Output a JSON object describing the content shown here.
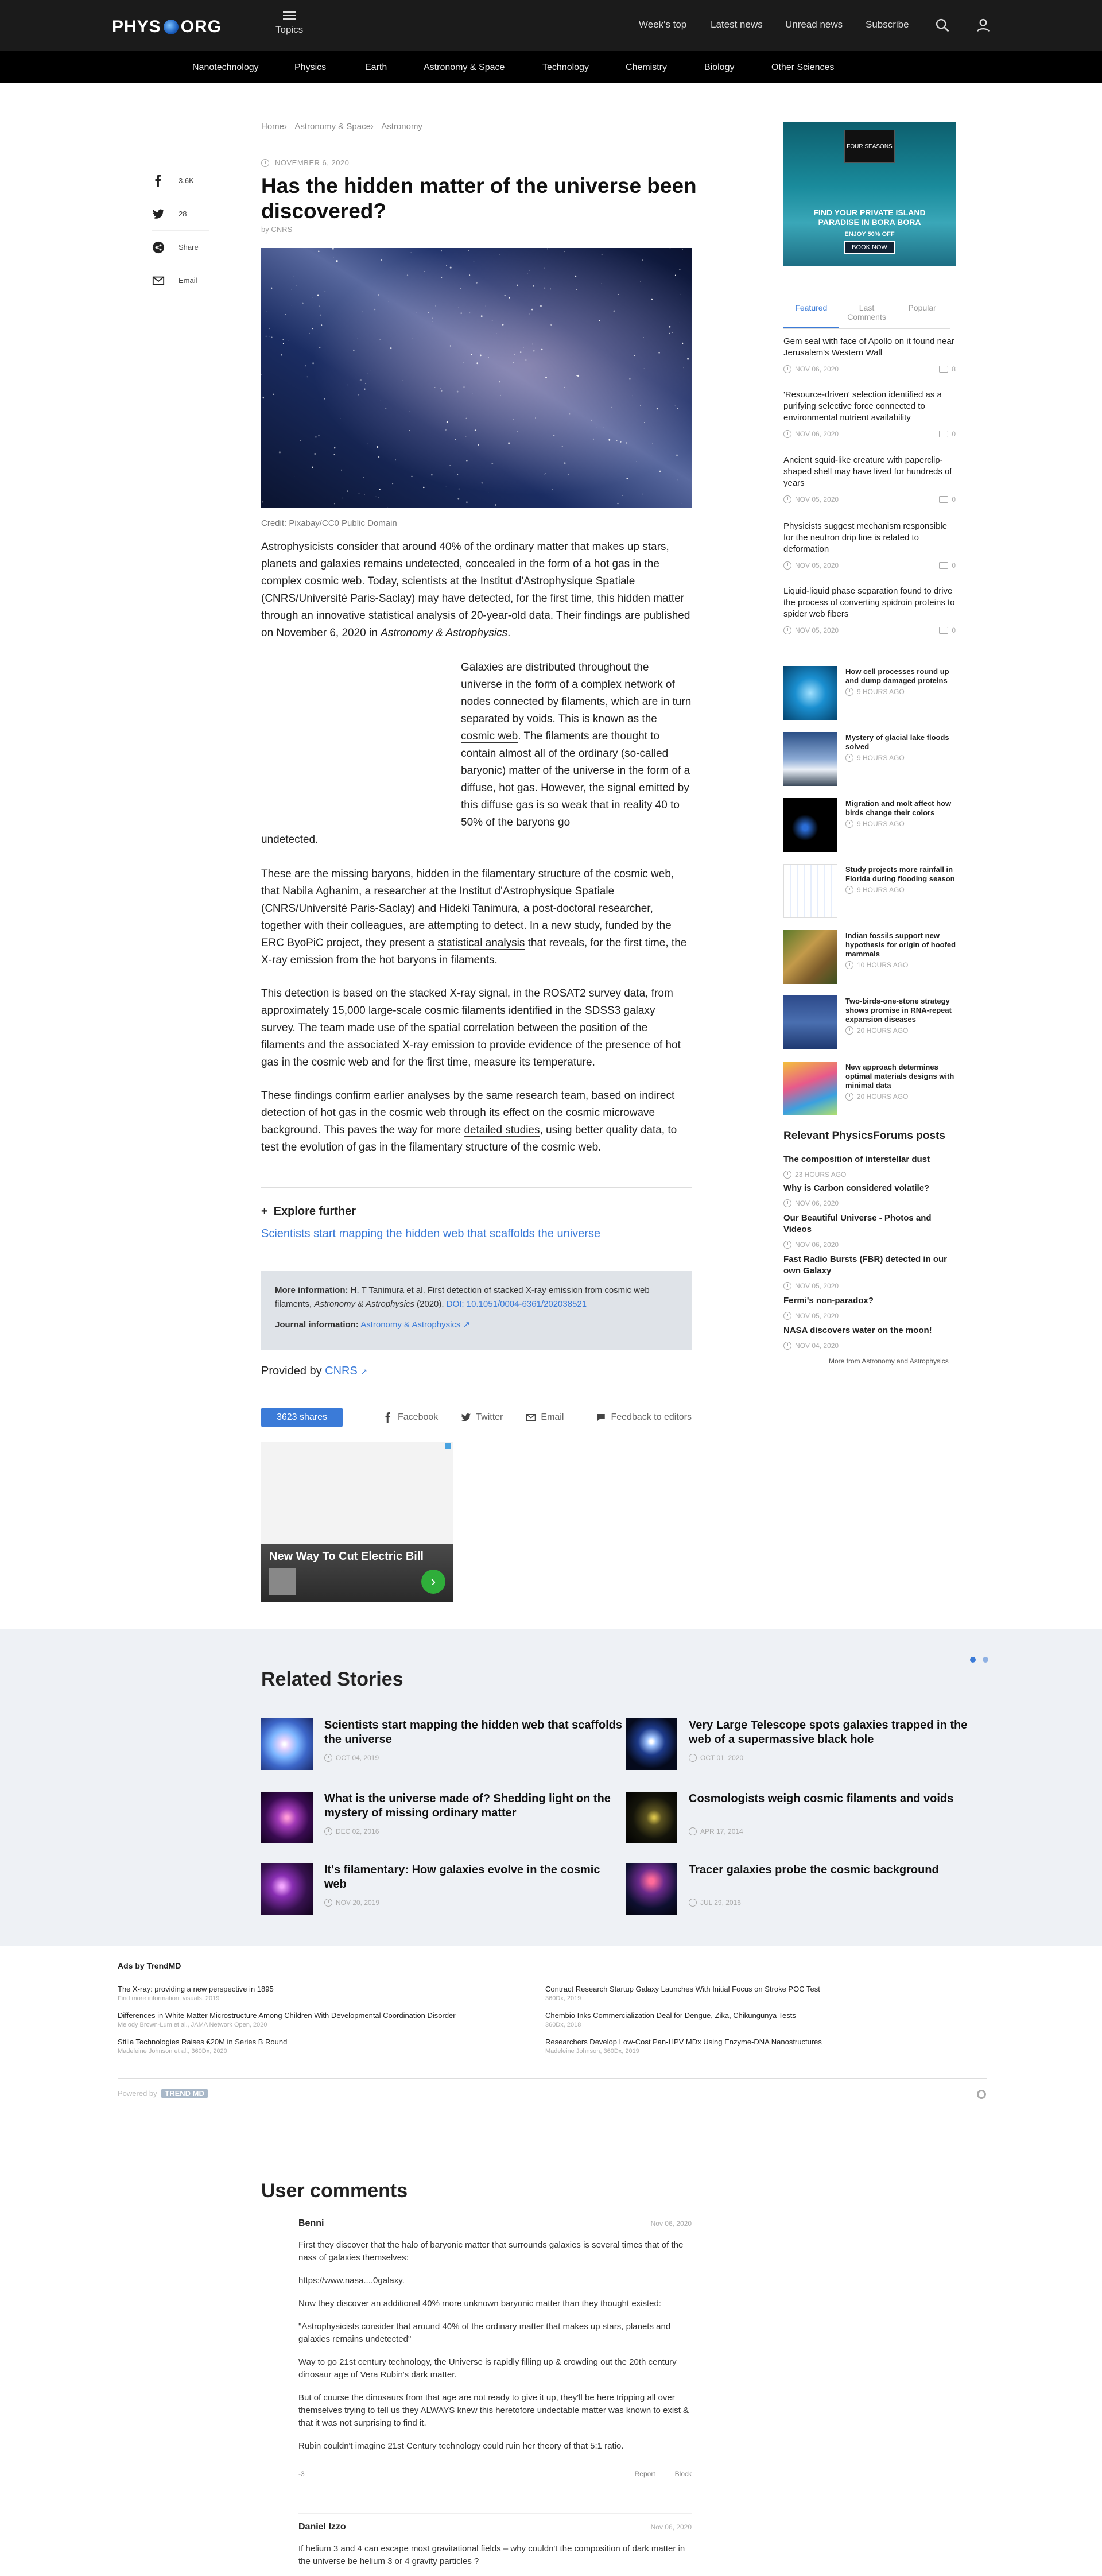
{
  "header": {
    "logo_left": "PHYS",
    "logo_right": "ORG",
    "topics": "Topics",
    "nav": [
      "Week's top",
      "Latest news",
      "Unread news",
      "Subscribe"
    ]
  },
  "categories": [
    "Nanotechnology",
    "Physics",
    "Earth",
    "Astronomy & Space",
    "Technology",
    "Chemistry",
    "Biology",
    "Other Sciences"
  ],
  "social": {
    "facebook_count": "3.6K",
    "twitter_count": "28",
    "share": "Share",
    "email": "Email"
  },
  "breadcrumb": [
    "Home",
    "Astronomy & Space",
    "Astronomy"
  ],
  "article": {
    "date": "NOVEMBER 6, 2020",
    "title": "Has the hidden matter of the universe been discovered?",
    "byline": "by CNRS",
    "credit": "Credit: Pixabay/CC0 Public Domain",
    "p1a": "Astrophysicists consider that around 40% of the ordinary matter that makes up stars, planets and galaxies remains undetected, concealed in the form of a hot gas in the complex cosmic web. Today, scientists at the Institut d'Astrophysique Spatiale (CNRS/Université Paris-Saclay) may have detected, for the first time, this hidden matter through an innovative statistical analysis of 20-year-old data. Their findings are published on November 6, 2020 in ",
    "p1_journal": "Astronomy & Astrophysics",
    "p1b": ".",
    "p2a": "Galaxies are distributed throughout the universe in the form of a complex network of nodes connected by filaments, which are in turn separated by voids. This is known as the ",
    "p2_link": "cosmic web",
    "p2b": ". The filaments are thought to contain almost all of the ordinary (so-called baryonic) matter of the universe in the form of a diffuse, hot gas. However, the signal emitted by this diffuse gas is so weak that in reality 40 to 50% of the baryons go",
    "p2_last": "undetected.",
    "p3a": "These are the missing baryons, hidden in the filamentary structure of the cosmic web, that Nabila Aghanim, a researcher at the Institut d'Astrophysique Spatiale (CNRS/Université Paris-Saclay) and Hideki Tanimura, a post-doctoral researcher, together with their colleagues, are attempting to detect. In a new study, funded by the ERC ByoPiC project, they present a ",
    "p3_link": "statistical analysis",
    "p3b": " that reveals, for the first time, the X-ray emission from the hot baryons in filaments.",
    "p4": "This detection is based on the stacked X-ray signal, in the ROSAT2 survey data, from approximately 15,000 large-scale cosmic filaments identified in the SDSS3 galaxy survey. The team made use of the spatial correlation between the position of the filaments and the associated X-ray emission to provide evidence of the presence of hot gas in the cosmic web and for the first time, measure its temperature.",
    "p5a": "These findings confirm earlier analyses by the same research team, based on indirect detection of hot gas in the cosmic web through its effect on the cosmic microwave background. This paves the way for more ",
    "p5_link": "detailed studies",
    "p5b": ", using better quality data, to test the evolution of gas in the filamentary structure of the cosmic web."
  },
  "explore": {
    "heading": "Explore further",
    "link": "Scientists start mapping the hidden web that scaffolds the universe"
  },
  "moreinfo": {
    "label": "More information:",
    "text_a": " H. T Tanimura et al. First detection of stacked X-ray emission from cosmic web filaments, ",
    "journal": "Astronomy & Astrophysics",
    "text_b": " (2020). ",
    "doi": "DOI: 10.1051/0004-6361/202038521",
    "journal_label": "Journal information:",
    "journal_link": "Astronomy & Astrophysics"
  },
  "provided": {
    "label": "Provided by ",
    "org": "CNRS"
  },
  "sharebar": {
    "shares": "3623 shares",
    "facebook": "Facebook",
    "twitter": "Twitter",
    "email": "Email",
    "feedback": "Feedback to editors"
  },
  "ad": {
    "headline": "New Way To Cut Electric Bill"
  },
  "sidead": {
    "brand": "FOUR SEASONS",
    "line1": "FIND YOUR PRIVATE ISLAND",
    "line2": "PARADISE IN BORA BORA",
    "offer": "ENJOY 50% OFF",
    "button": "BOOK NOW"
  },
  "tabs": [
    "Featured",
    "Last Comments",
    "Popular"
  ],
  "featured": [
    {
      "title": "Gem seal with face of Apollo on it found near Jerusalem's Western Wall",
      "date": "NOV 06, 2020",
      "comments": "8"
    },
    {
      "title": "'Resource-driven' selection identified as a purifying selective force connected to environmental nutrient availability",
      "date": "NOV 06, 2020",
      "comments": "0"
    },
    {
      "title": "Ancient squid-like creature with paperclip-shaped shell may have lived for hundreds of years",
      "date": "NOV 05, 2020",
      "comments": "0"
    },
    {
      "title": "Physicists suggest mechanism responsible for the neutron drip line is related to deformation",
      "date": "NOV 05, 2020",
      "comments": "0"
    },
    {
      "title": "Liquid-liquid phase separation found to drive the process of converting spidroin proteins to spider web fibers",
      "date": "NOV 05, 2020",
      "comments": "0"
    }
  ],
  "thumbs": [
    {
      "title": "How cell processes round up and dump damaged proteins",
      "time": "9 HOURS AGO"
    },
    {
      "title": "Mystery of glacial lake floods solved",
      "time": "9 HOURS AGO"
    },
    {
      "title": "Migration and molt affect how birds change their colors",
      "time": "9 HOURS AGO"
    },
    {
      "title": "Study projects more rainfall in Florida during flooding season",
      "time": "9 HOURS AGO"
    },
    {
      "title": "Indian fossils support new hypothesis for origin of hoofed mammals",
      "time": "10 HOURS AGO"
    },
    {
      "title": "Two-birds-one-stone strategy shows promise in RNA-repeat expansion diseases",
      "time": "20 HOURS AGO"
    },
    {
      "title": "New approach determines optimal materials designs with minimal data",
      "time": "20 HOURS AGO"
    }
  ],
  "physicsforums": {
    "heading": "Relevant PhysicsForums posts",
    "posts": [
      {
        "title": "The composition of interstellar dust",
        "time": "23 HOURS AGO"
      },
      {
        "title": "Why is Carbon considered volatile?",
        "time": "NOV 06, 2020"
      },
      {
        "title": "Our Beautiful Universe - Photos and Videos",
        "time": "NOV 06, 2020"
      },
      {
        "title": "Fast Radio Bursts (FBR) detected in our own Galaxy",
        "time": "NOV 05, 2020"
      },
      {
        "title": "Fermi's non-paradox?",
        "time": "NOV 05, 2020"
      },
      {
        "title": "NASA discovers water on the moon!",
        "time": "NOV 04, 2020"
      }
    ],
    "more": "More from Astronomy and Astrophysics"
  },
  "related": {
    "heading": "Related Stories",
    "items": [
      {
        "title": "Scientists start mapping the hidden web that scaffolds the universe",
        "date": "OCT 04, 2019"
      },
      {
        "title": "Very Large Telescope spots galaxies trapped in the web of a supermassive black hole",
        "date": "OCT 01, 2020"
      },
      {
        "title": "What is the universe made of? Shedding light on the mystery of missing ordinary matter",
        "date": "DEC 02, 2016"
      },
      {
        "title": "Cosmologists weigh cosmic filaments and voids",
        "date": "APR 17, 2014"
      },
      {
        "title": "It's filamentary: How galaxies evolve in the cosmic web",
        "date": "NOV 20, 2019"
      },
      {
        "title": "Tracer galaxies probe the cosmic background",
        "date": "JUL 29, 2016"
      }
    ]
  },
  "trendmd": {
    "heading": "Ads by TrendMD",
    "left": [
      {
        "title": "The X-ray: providing a new perspective in 1895",
        "source": "Find more information, visuals, 2019"
      },
      {
        "title": "Differences in White Matter Microstructure Among Children With Developmental Coordination Disorder",
        "source": "Melody Brown-Lum et al., JAMA Network Open, 2020"
      },
      {
        "title": "Stilla Technologies Raises €20M in Series B Round",
        "source": "Madeleine Johnson et al., 360Dx, 2020"
      }
    ],
    "right": [
      {
        "title": "Contract Research Startup Galaxy Launches With Initial Focus on Stroke POC Test",
        "source": "360Dx, 2019"
      },
      {
        "title": "Chembio Inks Commercialization Deal for Dengue, Zika, Chikungunya Tests",
        "source": "360Dx, 2018"
      },
      {
        "title": "Researchers Develop Low-Cost Pan-HPV MDx Using Enzyme-DNA Nanostructures",
        "source": "Madeleine Johnson, 360Dx, 2019"
      }
    ],
    "powered": "Powered by",
    "brand": "TREND MD"
  },
  "comments": {
    "heading": "User comments",
    "items": [
      {
        "author": "Benni",
        "date": "Nov 06, 2020",
        "paragraphs": [
          "First they discover that the halo of baryonic matter that surrounds galaxies is several times that of the nass of galaxies themselves:",
          "https://www.nasa....0galaxy.",
          "Now they discover an additional 40% more unknown baryonic matter than they thought existed:",
          "\"Astrophysicists consider that around 40% of the ordinary matter that makes up stars, planets and galaxies remains undetected\"",
          "Way to go 21st century technology, the Universe is rapidly filling up & crowding out the 20th century dinosaur age of Vera Rubin's dark matter.",
          "But of course the dinosaurs from that age are not ready to give it up, they'll be here tripping all over themselves trying to tell us they ALWAYS knew this heretofore undectable matter was known to exist & that it was not surprising to find it.",
          "Rubin couldn't imagine 21st Century technology could ruin her theory of that 5:1 ratio."
        ],
        "score": "-3",
        "report": "Report",
        "block": "Block"
      },
      {
        "author": "Daniel Izzo",
        "date": "Nov 06, 2020",
        "paragraphs": [
          "If helium 3 and 4 can escape most gravitational fields – why couldn't the composition of dark matter in the universe be helium 3 or 4 gravity particles ?"
        ]
      }
    ]
  }
}
